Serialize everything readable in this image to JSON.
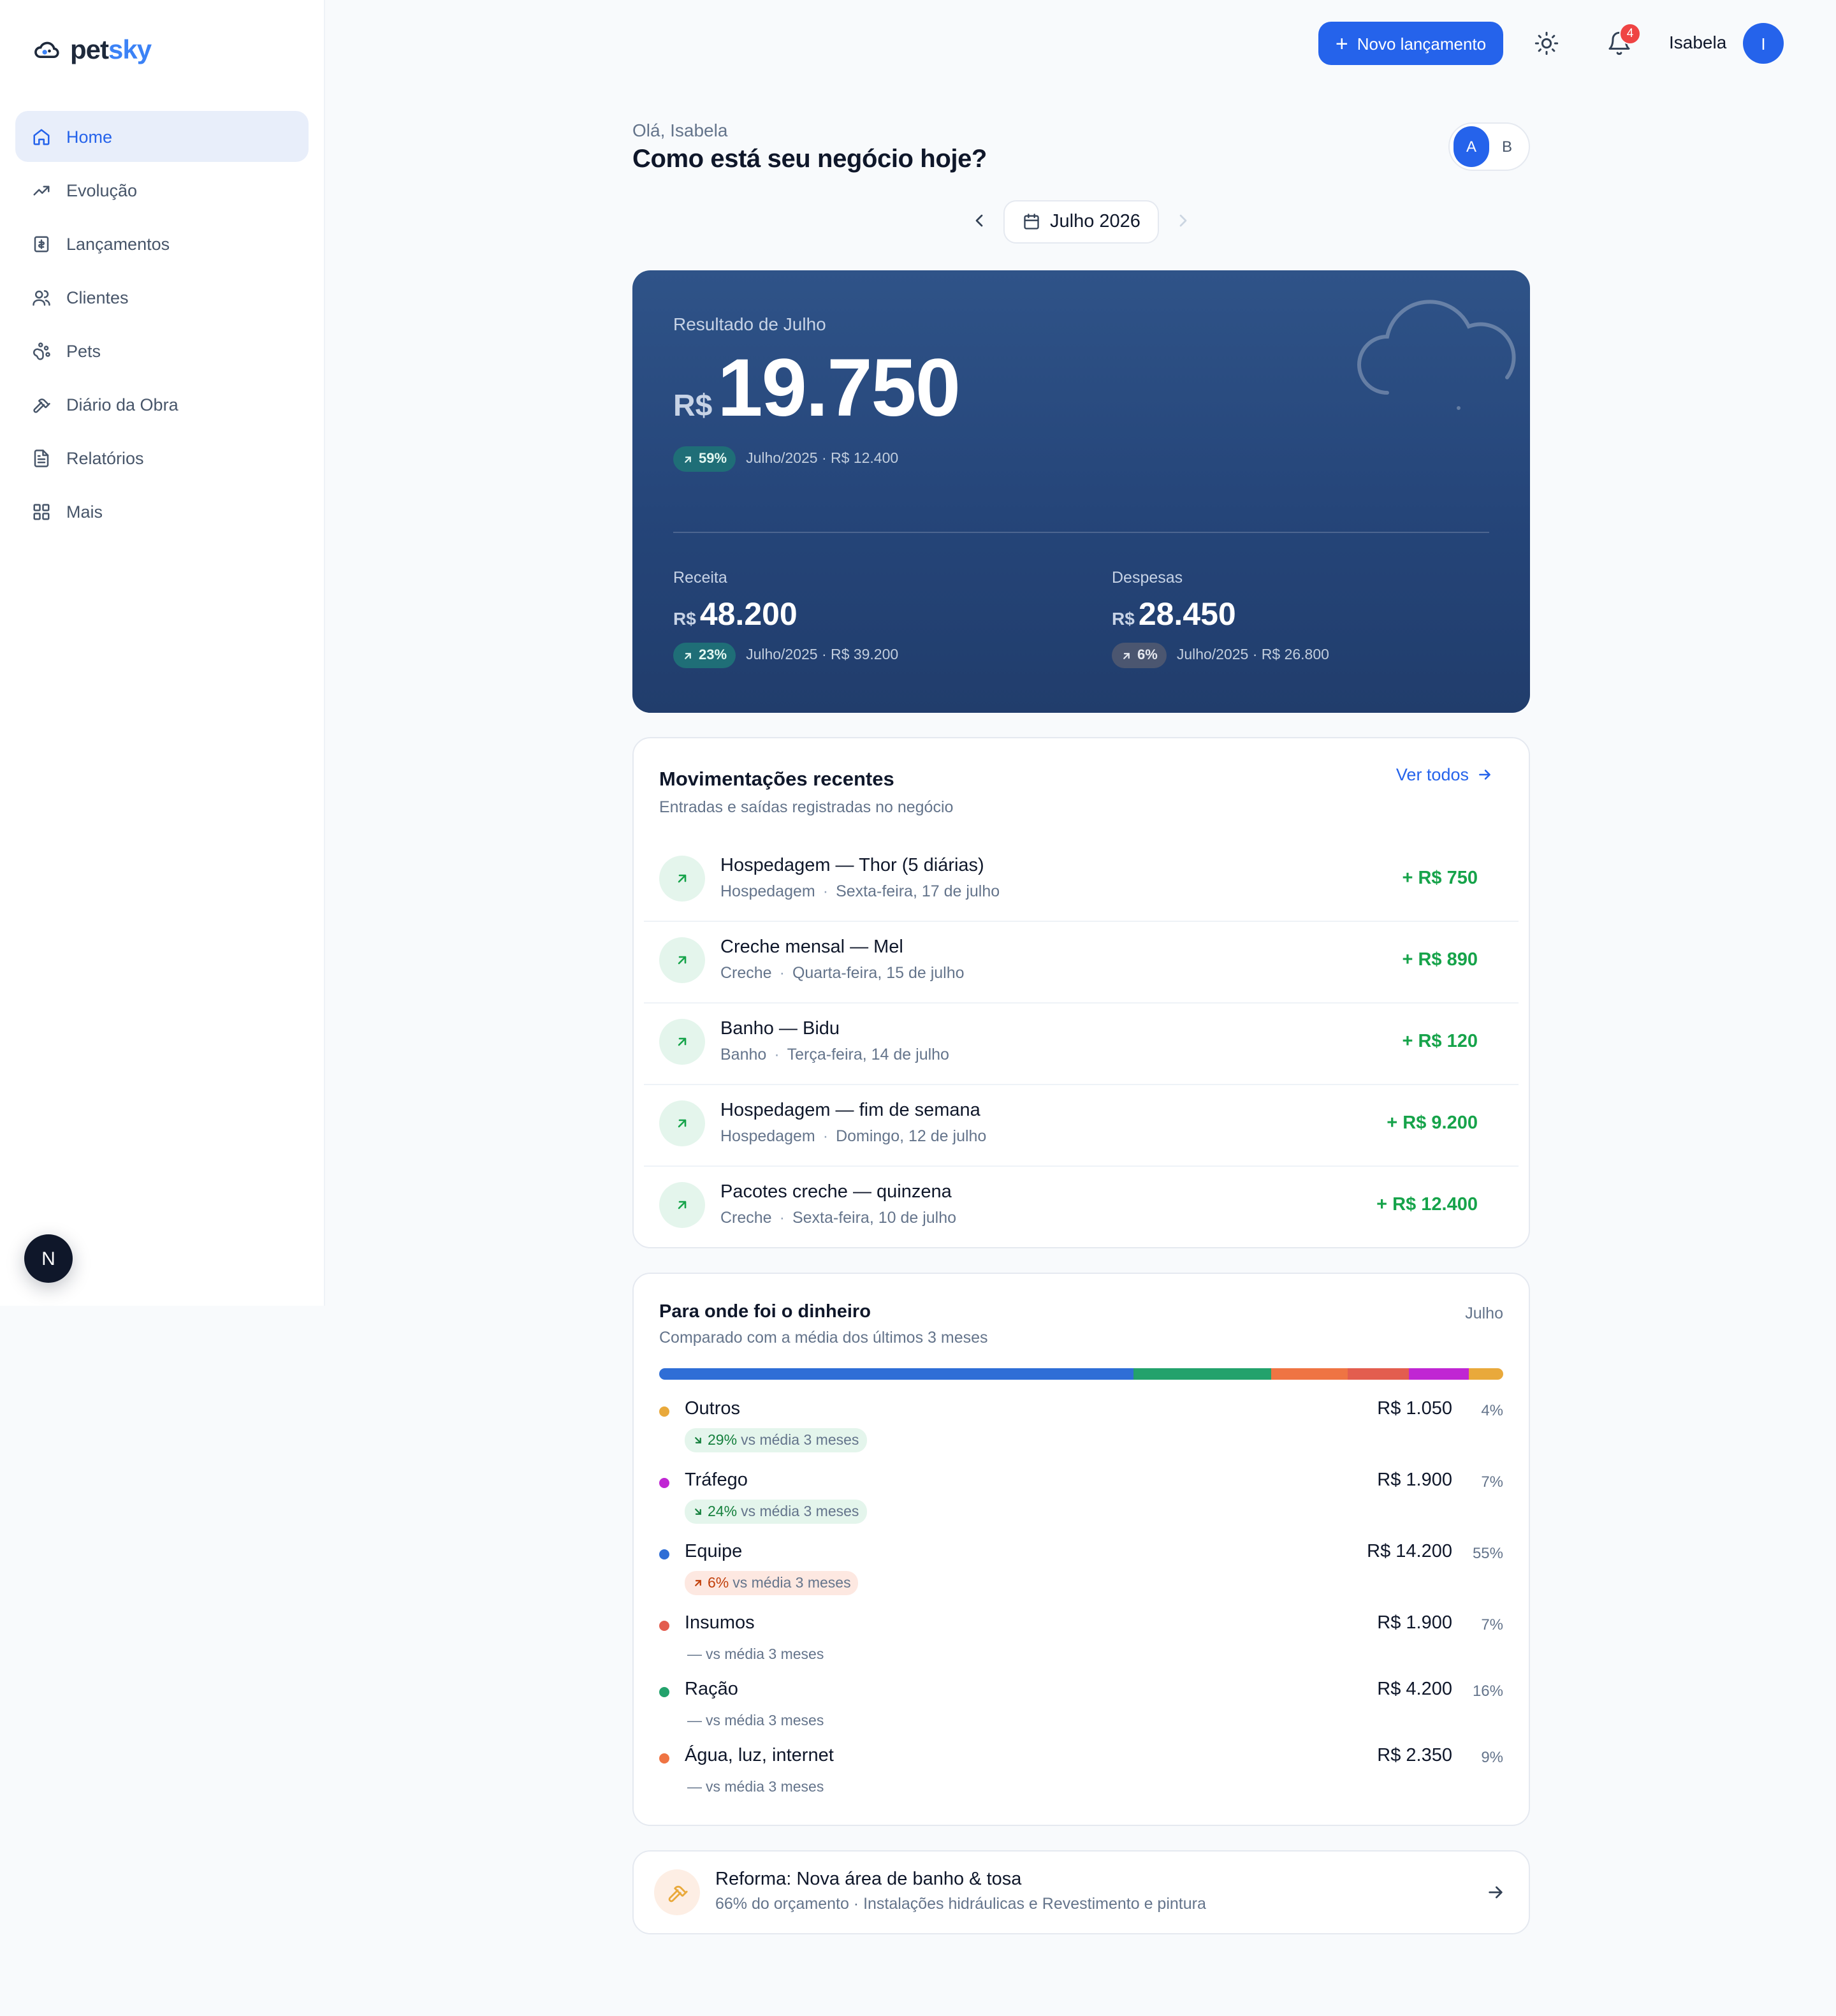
{
  "brand": {
    "part1": "pet",
    "part2": "sky",
    "icon": "paw-cloud-logo"
  },
  "sidebar": {
    "items": [
      {
        "label": "Home",
        "icon": "home-icon",
        "active": true
      },
      {
        "label": "Evolução",
        "icon": "trending-up-icon"
      },
      {
        "label": "Lançamentos",
        "icon": "receipt-icon"
      },
      {
        "label": "Clientes",
        "icon": "users-icon"
      },
      {
        "label": "Pets",
        "icon": "paw-icon"
      },
      {
        "label": "Diário da Obra",
        "icon": "hammer-icon"
      },
      {
        "label": "Relatórios",
        "icon": "file-text-icon"
      },
      {
        "label": "Mais",
        "icon": "grid-icon"
      }
    ],
    "floating_badge": "N"
  },
  "topbar": {
    "new_entry_label": "Novo lançamento",
    "notifications_count": "4",
    "user_name": "Isabela",
    "avatar_initial": "I"
  },
  "header": {
    "greeting": "Olá, Isabela",
    "title": "Como está seu negócio hoje?",
    "variant_a": "A",
    "variant_b": "B",
    "month": "Julho 2026"
  },
  "hero": {
    "label": "Resultado de Julho",
    "currency": "R$",
    "amount": "19.750",
    "change": "59%",
    "comparison": "Julho/2025 · R$ 12.400",
    "revenue": {
      "label": "Receita",
      "currency": "R$",
      "amount": "48.200",
      "change": "23%",
      "comparison": "Julho/2025 · R$ 39.200"
    },
    "expenses": {
      "label": "Despesas",
      "currency": "R$",
      "amount": "28.450",
      "change": "6%",
      "comparison": "Julho/2025 · R$ 26.800"
    }
  },
  "transactions": {
    "title": "Movimentações recentes",
    "subtitle": "Entradas e saídas registradas no negócio",
    "see_all": "Ver todos",
    "items": [
      {
        "title": "Hospedagem — Thor (5 diárias)",
        "category": "Hospedagem",
        "date": "Sexta-feira, 17 de julho",
        "amount": "+ R$ 750"
      },
      {
        "title": "Creche mensal — Mel",
        "category": "Creche",
        "date": "Quarta-feira, 15 de julho",
        "amount": "+ R$ 890"
      },
      {
        "title": "Banho — Bidu",
        "category": "Banho",
        "date": "Terça-feira, 14 de julho",
        "amount": "+ R$ 120"
      },
      {
        "title": "Hospedagem — fim de semana",
        "category": "Hospedagem",
        "date": "Domingo, 12 de julho",
        "amount": "+ R$ 9.200"
      },
      {
        "title": "Pacotes creche — quinzena",
        "category": "Creche",
        "date": "Sexta-feira, 10 de julho",
        "amount": "+ R$ 12.400"
      }
    ]
  },
  "spending": {
    "title": "Para onde foi o dinheiro",
    "subtitle": "Comparado com a média dos últimos 3 meses",
    "month": "Julho",
    "vs_suffix": "vs média 3 meses",
    "categories": [
      {
        "name": "Outros",
        "value": "R$ 1.050",
        "pct": "4%",
        "share": 4,
        "color": "#e9a93b",
        "trend": "down",
        "trend_value": "29%"
      },
      {
        "name": "Tráfego",
        "value": "R$ 1.900",
        "pct": "7%",
        "share": 7,
        "color": "#c026d3",
        "trend": "down",
        "trend_value": "24%"
      },
      {
        "name": "Equipe",
        "value": "R$ 14.200",
        "pct": "55%",
        "share": 55,
        "color": "#2f6ed6",
        "trend": "up",
        "trend_value": "6%"
      },
      {
        "name": "Insumos",
        "value": "R$ 1.900",
        "pct": "7%",
        "share": 7,
        "color": "#e35d4f",
        "trend": "flat",
        "trend_value": "—"
      },
      {
        "name": "Ração",
        "value": "R$ 4.200",
        "pct": "16%",
        "share": 16,
        "color": "#23a26c",
        "trend": "flat",
        "trend_value": "—"
      },
      {
        "name": "Água, luz, internet",
        "value": "R$ 2.350",
        "pct": "9%",
        "share": 9,
        "color": "#ef7443",
        "trend": "flat",
        "trend_value": "—"
      }
    ],
    "bar_order": [
      "Equipe",
      "Ração",
      "Água, luz, internet",
      "Insumos",
      "Tráfego",
      "Outros"
    ]
  },
  "project": {
    "title": "Reforma: Nova área de banho & tosa",
    "subtitle": "66% do orçamento · Instalações hidráulicas e Revestimento e pintura",
    "progress_pct": 66
  },
  "colors": {
    "accent": "#2563eb",
    "positive": "#16a34a",
    "hero_bg": "#254579"
  }
}
